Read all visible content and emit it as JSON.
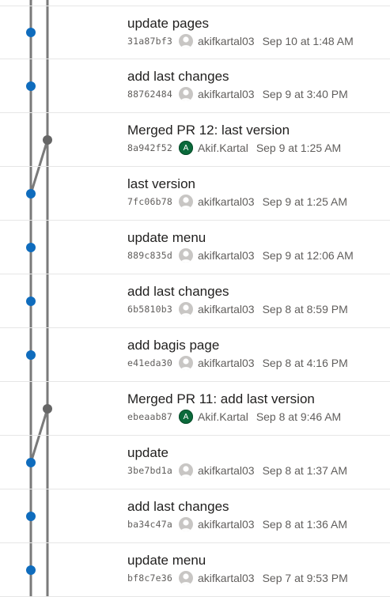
{
  "colors": {
    "main_line": "#7a7a7a",
    "commit_dot": "#0f6cbd",
    "merge_dot": "#666666",
    "author_badge": "#0b6a3b"
  },
  "commits": [
    {
      "title": "update pages",
      "hash": "31a87bf3",
      "author": "akifkartal03",
      "date": "Sep 10 at 1:48 AM",
      "avatar": "person-icon",
      "merge": false
    },
    {
      "title": "add last changes",
      "hash": "88762484",
      "author": "akifkartal03",
      "date": "Sep 9 at 3:40 PM",
      "avatar": "person-icon",
      "merge": false
    },
    {
      "title": "Merged PR 12: last version",
      "hash": "8a942f52",
      "author": "Akif.Kartal",
      "date": "Sep 9 at 1:25 AM",
      "avatar": "A",
      "merge": true
    },
    {
      "title": "last version",
      "hash": "7fc06b78",
      "author": "akifkartal03",
      "date": "Sep 9 at 1:25 AM",
      "avatar": "person-icon",
      "merge": false
    },
    {
      "title": "update menu",
      "hash": "889c835d",
      "author": "akifkartal03",
      "date": "Sep 9 at 12:06 AM",
      "avatar": "person-icon",
      "merge": false
    },
    {
      "title": "add last changes",
      "hash": "6b5810b3",
      "author": "akifkartal03",
      "date": "Sep 8 at 8:59 PM",
      "avatar": "person-icon",
      "merge": false
    },
    {
      "title": "add bagis page",
      "hash": "e41eda30",
      "author": "akifkartal03",
      "date": "Sep 8 at 4:16 PM",
      "avatar": "person-icon",
      "merge": false
    },
    {
      "title": "Merged PR 11: add last version",
      "hash": "ebeaab87",
      "author": "Akif.Kartal",
      "date": "Sep 8 at 9:46 AM",
      "avatar": "A",
      "merge": true
    },
    {
      "title": "update",
      "hash": "3be7bd1a",
      "author": "akifkartal03",
      "date": "Sep 8 at 1:37 AM",
      "avatar": "person-icon",
      "merge": false
    },
    {
      "title": "add last changes",
      "hash": "ba34c47a",
      "author": "akifkartal03",
      "date": "Sep 8 at 1:36 AM",
      "avatar": "person-icon",
      "merge": false
    },
    {
      "title": "update menu",
      "hash": "bf8c7e36",
      "author": "akifkartal03",
      "date": "Sep 7 at 9:53 PM",
      "avatar": "person-icon",
      "merge": false
    }
  ]
}
